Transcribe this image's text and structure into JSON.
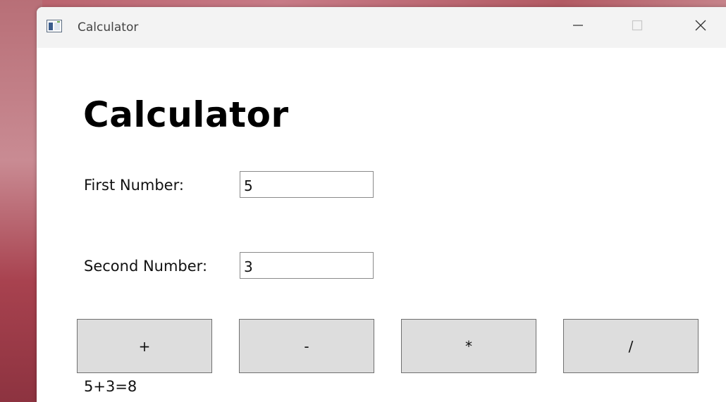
{
  "window": {
    "title": "Calculator",
    "icon": "app-window-icon",
    "controls": [
      "minimize-icon",
      "maximize-icon",
      "close-icon"
    ]
  },
  "main": {
    "heading": "Calculator",
    "first_number": {
      "label": "First Number:",
      "value": "5"
    },
    "second_number": {
      "label": "Second Number:",
      "value": "3"
    },
    "operations": [
      "+",
      "-",
      "*",
      "/"
    ],
    "result": "5+3=8"
  },
  "colors": {
    "button_bg": "#dddddd",
    "button_border": "#707070",
    "titlebar_bg": "#f3f3f3"
  }
}
